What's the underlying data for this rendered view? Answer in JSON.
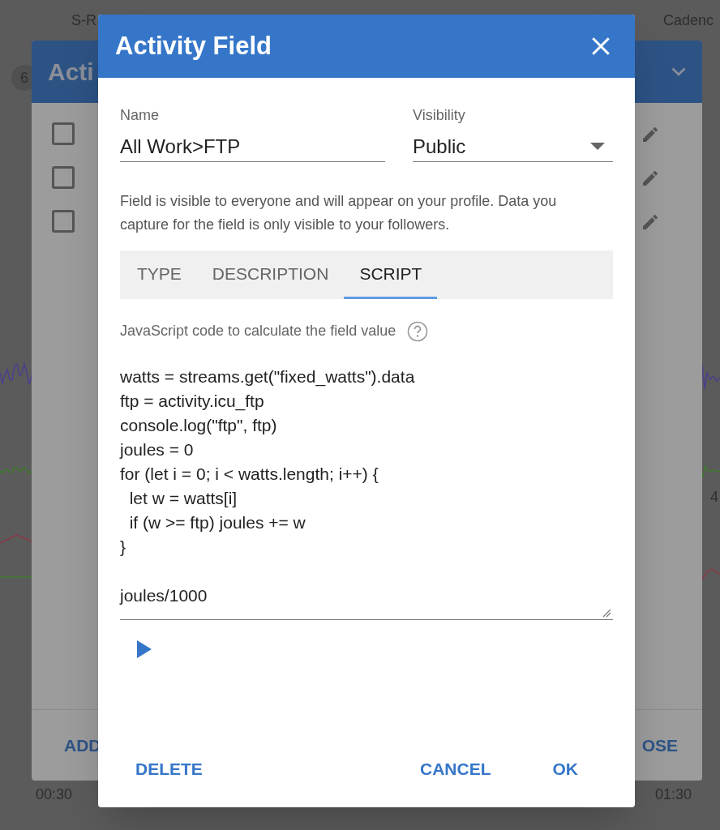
{
  "background": {
    "stats": [
      "S-R",
      "Cadenc"
    ],
    "panel": {
      "title": "Acti",
      "badge": "6",
      "buttons": [
        "ADD",
        "OSE"
      ],
      "checkboxes": [
        {
          "checked": false
        },
        {
          "checked": false
        },
        {
          "checked": false
        }
      ]
    },
    "axis_label": "4",
    "times": [
      "00:30",
      "01:30"
    ]
  },
  "dialog": {
    "title": "Activity Field",
    "name": {
      "label": "Name",
      "value": "All Work>FTP"
    },
    "visibility": {
      "label": "Visibility",
      "value": "Public"
    },
    "description": "Field is visible to everyone and will appear on your profile. Data you capture for the field is only visible to your followers.",
    "tabs": [
      {
        "label": "TYPE",
        "selected": false
      },
      {
        "label": "DESCRIPTION",
        "selected": false
      },
      {
        "label": "SCRIPT",
        "selected": true
      }
    ],
    "script_hint": "JavaScript code to calculate the field value",
    "code_blocks": [
      [
        "watts = streams.get(\"fixed_watts\").data",
        "ftp = activity.icu_ftp",
        "console.log(\"ftp\", ftp)",
        "joules = 0",
        "for (let i = 0; i < watts.length; i++) {",
        "  let w = watts[i]",
        "  if (w >= ftp) joules += w",
        "}"
      ],
      [
        "joules/1000"
      ]
    ],
    "buttons": {
      "left": "DELETE",
      "right": [
        "CANCEL",
        "OK"
      ]
    }
  }
}
